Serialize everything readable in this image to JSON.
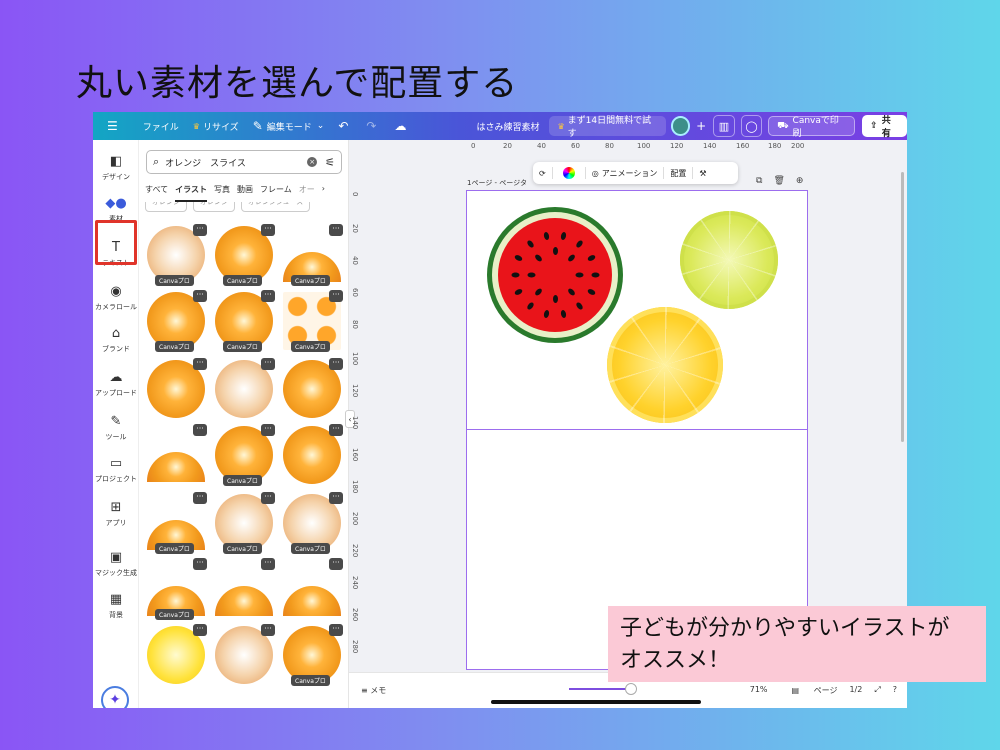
{
  "slide": {
    "title": "丸い素材を選んで配置する",
    "callout": "子どもが分かりやすいイラストが\nオススメ！"
  },
  "topbar": {
    "menu_icon": "hamburger-icon",
    "file": "ファイル",
    "resize": "リサイズ",
    "edit_mode": "編集モード",
    "design_name": "はさみ練習素材",
    "trial": "まず14日間無料で試す",
    "print": "Canvaで印刷",
    "share": "共有"
  },
  "rail": [
    {
      "label": "デザイン",
      "icon": "design-icon"
    },
    {
      "label": "素材",
      "icon": "elements-icon"
    },
    {
      "label": "テキスト",
      "icon": "text-icon"
    },
    {
      "label": "カメラロール",
      "icon": "camera-icon"
    },
    {
      "label": "ブランド",
      "icon": "brand-icon"
    },
    {
      "label": "アップロード",
      "icon": "upload-icon"
    },
    {
      "label": "ツール",
      "icon": "tool-icon"
    },
    {
      "label": "プロジェクト",
      "icon": "folder-icon"
    },
    {
      "label": "アプリ",
      "icon": "apps-icon"
    },
    {
      "label": "マジック生成",
      "icon": "magic-media-icon"
    },
    {
      "label": "背景",
      "icon": "background-icon"
    }
  ],
  "panel": {
    "search_value": "オレンジ　スライス",
    "tabs": [
      "すべて",
      "イラスト",
      "写真",
      "動画",
      "フレーム",
      "オー"
    ],
    "active_tab": "イラスト",
    "chips": [
      "オレンジ",
      "オレンジ",
      "オレンジジュース"
    ],
    "pro_badge": "Canvaプロ",
    "more": "···"
  },
  "rulers": {
    "top": [
      "0",
      "20",
      "40",
      "60",
      "80",
      "100",
      "120",
      "140",
      "160",
      "180",
      "200"
    ],
    "left": [
      "0",
      "20",
      "40",
      "60",
      "80",
      "100",
      "120",
      "140",
      "160",
      "180",
      "200",
      "220",
      "240",
      "260",
      "280"
    ]
  },
  "context_bar": {
    "animation": "アニメーション",
    "position": "配置"
  },
  "page": {
    "label": "1ページ - ページタ"
  },
  "bottombar": {
    "memo": "メモ",
    "zoom": "71%",
    "page_label": "ページ",
    "page_count": "1/2"
  },
  "colors": {
    "selection": "#9c6dee",
    "highlight_box": "#e0342a",
    "callout_bg": "#fbc9d6"
  }
}
